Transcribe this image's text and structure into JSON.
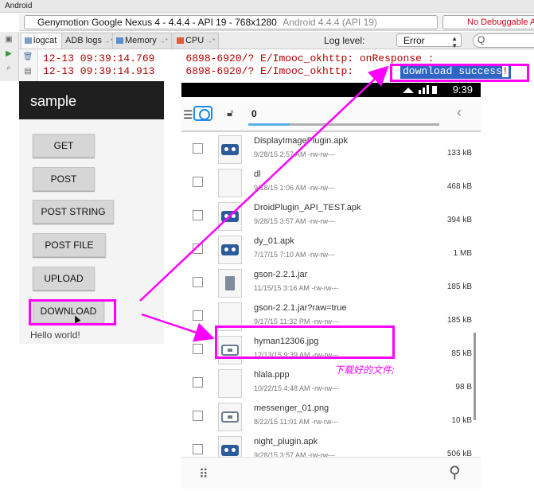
{
  "studio": {
    "window_title": "Android",
    "device_label": "Genymotion Google Nexus 4 - 4.4.4 - API 19 - 768x1280",
    "device_os": "Android 4.4.4 (API 19)",
    "debuggable": "No Debuggable App",
    "tabs": [
      {
        "label": "logcat",
        "icon": "logcat-icon"
      },
      {
        "label": "ADB logs",
        "icon": "adb-icon"
      },
      {
        "label": "Memory",
        "icon": "memory-icon"
      },
      {
        "label": "CPU",
        "icon": "cpu-icon"
      }
    ],
    "log_level_label": "Log level:",
    "log_level_value": "Error",
    "search_glyph": "Q",
    "log_lines": [
      "12-13 09:39:14.769     6898-6920/? E/Imooc_okhttp: onResponse :",
      "12-13 09:39:14.913     6898-6920/? E/Imooc_okhttp: "
    ],
    "selected_text": "download success",
    "selected_trail": "!"
  },
  "app": {
    "title": "sample",
    "buttons": [
      "GET",
      "POST",
      "POST STRING",
      "POST FILE",
      "UPLOAD",
      "DOWNLOAD"
    ],
    "hello": "Hello world!"
  },
  "phone": {
    "time": "9:39",
    "path": "0",
    "files": [
      {
        "name": "DisplayImagePlugin.apk",
        "meta": "9/28/15 2:57 AM  -rw-rw---",
        "size": "133 kB",
        "icon": "android-icon"
      },
      {
        "name": "dl",
        "meta": "9/18/15 1:06 AM  -rw-rw---",
        "size": "468 kB",
        "icon": "blank-file-icon"
      },
      {
        "name": "DroidPlugin_API_TEST.apk",
        "meta": "9/28/15 3:57 AM  -rw-rw---",
        "size": "394 kB",
        "icon": "android-icon"
      },
      {
        "name": "dy_01.apk",
        "meta": "7/17/15 7:10 AM  -rw-rw---",
        "size": "1 MB",
        "icon": "android-icon"
      },
      {
        "name": "gson-2.2.1.jar",
        "meta": "11/15/15 3:16 AM  -rw-rw---",
        "size": "185 kB",
        "icon": "jar-icon"
      },
      {
        "name": "gson-2.2.1.jar?raw=true",
        "meta": "9/17/15 11:32 PM  -rw-rw---",
        "size": "185 kB",
        "icon": "blank-file-icon"
      },
      {
        "name": "hyman12306.jpg",
        "meta": "12/13/15 9:39 AM  -rw-rw---",
        "size": "85 kB",
        "icon": "image-icon"
      },
      {
        "name": "hlala.ppp",
        "meta": "10/22/15 4:48 AM  -rw-rw---",
        "size": "98 B",
        "icon": "blank-file-icon"
      },
      {
        "name": "messenger_01.png",
        "meta": "8/22/15 11:01 AM  -rw-rw---",
        "size": "10 kB",
        "icon": "image-icon"
      },
      {
        "name": "night_plugin.apk",
        "meta": "9/28/15 3:57 AM  -rw-rw---",
        "size": "506 kB",
        "icon": "android-icon"
      }
    ]
  },
  "annotation": {
    "note": "下载好的文件;",
    "color": "#ff00ff"
  }
}
